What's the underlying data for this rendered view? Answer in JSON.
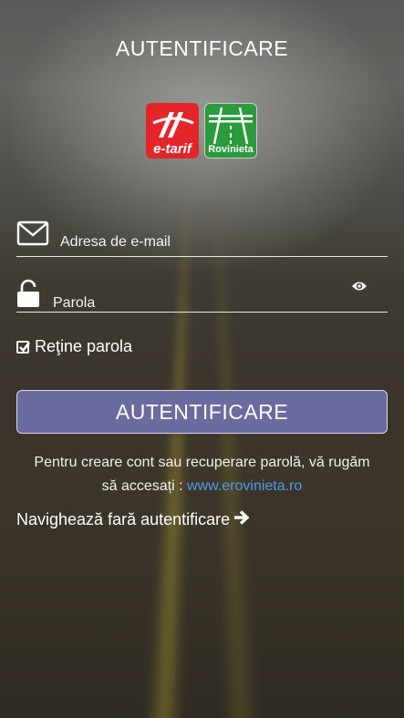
{
  "header": {
    "title": "AUTENTIFICARE"
  },
  "logos": {
    "etarif_label": "e-tarif",
    "rovinieta_label": "Rovinieta"
  },
  "form": {
    "email_placeholder": "Adresa de e-mail",
    "password_placeholder": "Parola",
    "remember_label": "Reţine parola",
    "remember_checked": true,
    "submit_label": "AUTENTIFICARE"
  },
  "info": {
    "text": "Pentru creare cont sau recuperare parolă, vă rugăm să accesați : ",
    "link_text": "www.erovinieta.ro"
  },
  "guest_link": {
    "label": "Navighează fară autentificare"
  },
  "colors": {
    "button_bg": "#6b6b9f",
    "link": "#4f9be8",
    "etarif_red": "#e3262a",
    "rovinieta_green": "#2a9a3c"
  }
}
